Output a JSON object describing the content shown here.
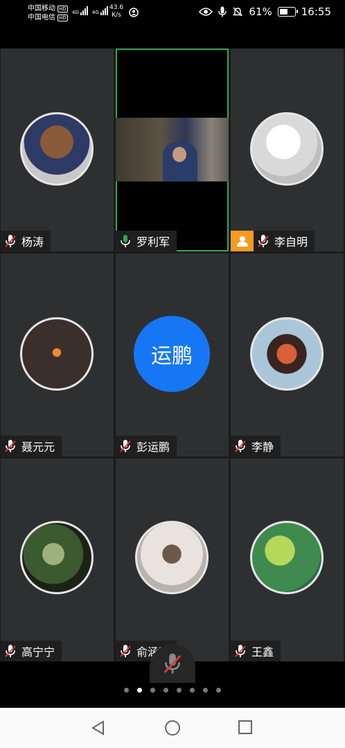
{
  "status_bar": {
    "carrier1": "中国移动",
    "carrier2": "中国电信",
    "hd": "HD",
    "net1": "4G",
    "net2": "4G",
    "speed_value": "43.6",
    "speed_unit": "K/s",
    "battery_percent": "61%",
    "battery_level": 0.61,
    "time": "16:55"
  },
  "participants": [
    {
      "name": "杨涛",
      "mic": "muted",
      "view": "avatar"
    },
    {
      "name": "罗利军",
      "mic": "on",
      "view": "video",
      "active": true
    },
    {
      "name": "李自明",
      "mic": "muted",
      "view": "avatar",
      "host_badge": true
    },
    {
      "name": "聂元元",
      "mic": "muted",
      "view": "avatar"
    },
    {
      "name": "彭运鹏",
      "mic": "muted",
      "view": "initials",
      "initials": "运鹏"
    },
    {
      "name": "李静",
      "mic": "muted",
      "view": "avatar"
    },
    {
      "name": "高宁宁",
      "mic": "muted",
      "view": "avatar"
    },
    {
      "name": "俞涵曦",
      "mic": "muted",
      "view": "avatar"
    },
    {
      "name": "王鑫",
      "mic": "muted",
      "view": "avatar"
    }
  ],
  "colors": {
    "accent": "#1677f5",
    "active_border": "#2fa84f",
    "mic_on": "#2fa84f",
    "mic_muted": "#e53935",
    "host_badge": "#f59a23"
  },
  "pagination": {
    "count": 8,
    "current": 2
  }
}
